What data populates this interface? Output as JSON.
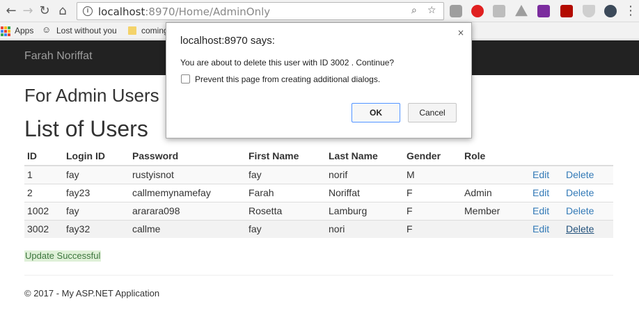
{
  "browser": {
    "url_host": "localhost",
    "url_path": ":8970/Home/AdminOnly",
    "bookmarks": [
      "Apps",
      "Lost without you",
      "coming"
    ]
  },
  "navbar": {
    "brand": "Farah Noriffat"
  },
  "page": {
    "heading": "For Admin Users",
    "list_title": "List of Users"
  },
  "table": {
    "columns": [
      "ID",
      "Login ID",
      "Password",
      "First Name",
      "Last Name",
      "Gender",
      "Role"
    ],
    "rows": [
      {
        "id": "1",
        "login": "fay",
        "password": "rustyisnot",
        "first": "fay",
        "last": "norif",
        "gender": "M",
        "role": "",
        "edit": "Edit",
        "delete": "Delete"
      },
      {
        "id": "2",
        "login": "fay23",
        "password": "callmemynamefay",
        "first": "Farah",
        "last": "Noriffat",
        "gender": "F",
        "role": "Admin",
        "edit": "Edit",
        "delete": "Delete"
      },
      {
        "id": "1002",
        "login": "fay",
        "password": "ararara098",
        "first": "Rosetta",
        "last": "Lamburg",
        "gender": "F",
        "role": "Member",
        "edit": "Edit",
        "delete": "Delete"
      },
      {
        "id": "3002",
        "login": "fay32",
        "password": "callme",
        "first": "fay",
        "last": "nori",
        "gender": "F",
        "role": "",
        "edit": "Edit",
        "delete": "Delete"
      }
    ]
  },
  "status": {
    "message": "Update Successful"
  },
  "footer": {
    "text": "© 2017 - My ASP.NET Application"
  },
  "dialog": {
    "title": "localhost:8970 says:",
    "message": "You are about to delete this user with ID 3002 . Continue?",
    "checkbox_label": "Prevent this page from creating additional dialogs.",
    "ok": "OK",
    "cancel": "Cancel",
    "close": "×"
  },
  "colors": {
    "navbar_bg": "#222222",
    "link": "#337ab7",
    "success_bg": "#dff0d8",
    "success_text": "#3c763d"
  }
}
